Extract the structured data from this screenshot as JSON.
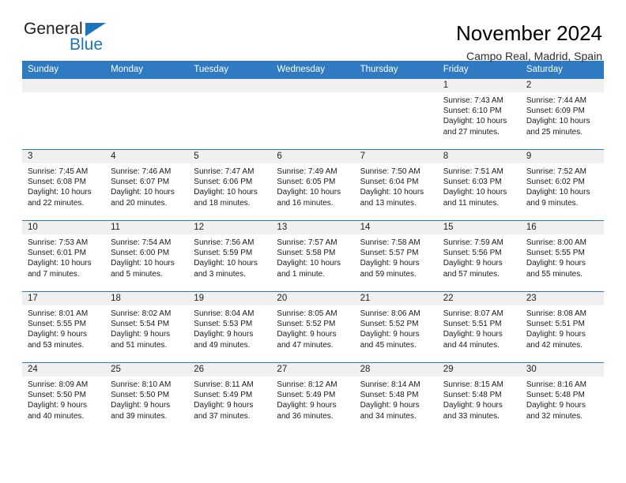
{
  "logo": {
    "word1": "General",
    "word2": "Blue",
    "triangle_color": "#1b75bb",
    "word1_color": "#231f20",
    "word2_color": "#1b75bb"
  },
  "header": {
    "title": "November 2024",
    "subtitle": "Campo Real, Madrid, Spain"
  },
  "theme": {
    "header_bg": "#2f7ac1",
    "header_text": "#ffffff",
    "daynum_bg": "#f0f0f0",
    "grid_line": "#2f7ac1"
  },
  "weekdays": [
    "Sunday",
    "Monday",
    "Tuesday",
    "Wednesday",
    "Thursday",
    "Friday",
    "Saturday"
  ],
  "weeks": [
    [
      {
        "day": "",
        "sunrise": "",
        "sunset": "",
        "daylight": "",
        "empty": true
      },
      {
        "day": "",
        "sunrise": "",
        "sunset": "",
        "daylight": "",
        "empty": true
      },
      {
        "day": "",
        "sunrise": "",
        "sunset": "",
        "daylight": "",
        "empty": true
      },
      {
        "day": "",
        "sunrise": "",
        "sunset": "",
        "daylight": "",
        "empty": true
      },
      {
        "day": "",
        "sunrise": "",
        "sunset": "",
        "daylight": "",
        "empty": true
      },
      {
        "day": "1",
        "sunrise": "Sunrise: 7:43 AM",
        "sunset": "Sunset: 6:10 PM",
        "daylight": "Daylight: 10 hours and 27 minutes.",
        "empty": false
      },
      {
        "day": "2",
        "sunrise": "Sunrise: 7:44 AM",
        "sunset": "Sunset: 6:09 PM",
        "daylight": "Daylight: 10 hours and 25 minutes.",
        "empty": false
      }
    ],
    [
      {
        "day": "3",
        "sunrise": "Sunrise: 7:45 AM",
        "sunset": "Sunset: 6:08 PM",
        "daylight": "Daylight: 10 hours and 22 minutes.",
        "empty": false
      },
      {
        "day": "4",
        "sunrise": "Sunrise: 7:46 AM",
        "sunset": "Sunset: 6:07 PM",
        "daylight": "Daylight: 10 hours and 20 minutes.",
        "empty": false
      },
      {
        "day": "5",
        "sunrise": "Sunrise: 7:47 AM",
        "sunset": "Sunset: 6:06 PM",
        "daylight": "Daylight: 10 hours and 18 minutes.",
        "empty": false
      },
      {
        "day": "6",
        "sunrise": "Sunrise: 7:49 AM",
        "sunset": "Sunset: 6:05 PM",
        "daylight": "Daylight: 10 hours and 16 minutes.",
        "empty": false
      },
      {
        "day": "7",
        "sunrise": "Sunrise: 7:50 AM",
        "sunset": "Sunset: 6:04 PM",
        "daylight": "Daylight: 10 hours and 13 minutes.",
        "empty": false
      },
      {
        "day": "8",
        "sunrise": "Sunrise: 7:51 AM",
        "sunset": "Sunset: 6:03 PM",
        "daylight": "Daylight: 10 hours and 11 minutes.",
        "empty": false
      },
      {
        "day": "9",
        "sunrise": "Sunrise: 7:52 AM",
        "sunset": "Sunset: 6:02 PM",
        "daylight": "Daylight: 10 hours and 9 minutes.",
        "empty": false
      }
    ],
    [
      {
        "day": "10",
        "sunrise": "Sunrise: 7:53 AM",
        "sunset": "Sunset: 6:01 PM",
        "daylight": "Daylight: 10 hours and 7 minutes.",
        "empty": false
      },
      {
        "day": "11",
        "sunrise": "Sunrise: 7:54 AM",
        "sunset": "Sunset: 6:00 PM",
        "daylight": "Daylight: 10 hours and 5 minutes.",
        "empty": false
      },
      {
        "day": "12",
        "sunrise": "Sunrise: 7:56 AM",
        "sunset": "Sunset: 5:59 PM",
        "daylight": "Daylight: 10 hours and 3 minutes.",
        "empty": false
      },
      {
        "day": "13",
        "sunrise": "Sunrise: 7:57 AM",
        "sunset": "Sunset: 5:58 PM",
        "daylight": "Daylight: 10 hours and 1 minute.",
        "empty": false
      },
      {
        "day": "14",
        "sunrise": "Sunrise: 7:58 AM",
        "sunset": "Sunset: 5:57 PM",
        "daylight": "Daylight: 9 hours and 59 minutes.",
        "empty": false
      },
      {
        "day": "15",
        "sunrise": "Sunrise: 7:59 AM",
        "sunset": "Sunset: 5:56 PM",
        "daylight": "Daylight: 9 hours and 57 minutes.",
        "empty": false
      },
      {
        "day": "16",
        "sunrise": "Sunrise: 8:00 AM",
        "sunset": "Sunset: 5:55 PM",
        "daylight": "Daylight: 9 hours and 55 minutes.",
        "empty": false
      }
    ],
    [
      {
        "day": "17",
        "sunrise": "Sunrise: 8:01 AM",
        "sunset": "Sunset: 5:55 PM",
        "daylight": "Daylight: 9 hours and 53 minutes.",
        "empty": false
      },
      {
        "day": "18",
        "sunrise": "Sunrise: 8:02 AM",
        "sunset": "Sunset: 5:54 PM",
        "daylight": "Daylight: 9 hours and 51 minutes.",
        "empty": false
      },
      {
        "day": "19",
        "sunrise": "Sunrise: 8:04 AM",
        "sunset": "Sunset: 5:53 PM",
        "daylight": "Daylight: 9 hours and 49 minutes.",
        "empty": false
      },
      {
        "day": "20",
        "sunrise": "Sunrise: 8:05 AM",
        "sunset": "Sunset: 5:52 PM",
        "daylight": "Daylight: 9 hours and 47 minutes.",
        "empty": false
      },
      {
        "day": "21",
        "sunrise": "Sunrise: 8:06 AM",
        "sunset": "Sunset: 5:52 PM",
        "daylight": "Daylight: 9 hours and 45 minutes.",
        "empty": false
      },
      {
        "day": "22",
        "sunrise": "Sunrise: 8:07 AM",
        "sunset": "Sunset: 5:51 PM",
        "daylight": "Daylight: 9 hours and 44 minutes.",
        "empty": false
      },
      {
        "day": "23",
        "sunrise": "Sunrise: 8:08 AM",
        "sunset": "Sunset: 5:51 PM",
        "daylight": "Daylight: 9 hours and 42 minutes.",
        "empty": false
      }
    ],
    [
      {
        "day": "24",
        "sunrise": "Sunrise: 8:09 AM",
        "sunset": "Sunset: 5:50 PM",
        "daylight": "Daylight: 9 hours and 40 minutes.",
        "empty": false
      },
      {
        "day": "25",
        "sunrise": "Sunrise: 8:10 AM",
        "sunset": "Sunset: 5:50 PM",
        "daylight": "Daylight: 9 hours and 39 minutes.",
        "empty": false
      },
      {
        "day": "26",
        "sunrise": "Sunrise: 8:11 AM",
        "sunset": "Sunset: 5:49 PM",
        "daylight": "Daylight: 9 hours and 37 minutes.",
        "empty": false
      },
      {
        "day": "27",
        "sunrise": "Sunrise: 8:12 AM",
        "sunset": "Sunset: 5:49 PM",
        "daylight": "Daylight: 9 hours and 36 minutes.",
        "empty": false
      },
      {
        "day": "28",
        "sunrise": "Sunrise: 8:14 AM",
        "sunset": "Sunset: 5:48 PM",
        "daylight": "Daylight: 9 hours and 34 minutes.",
        "empty": false
      },
      {
        "day": "29",
        "sunrise": "Sunrise: 8:15 AM",
        "sunset": "Sunset: 5:48 PM",
        "daylight": "Daylight: 9 hours and 33 minutes.",
        "empty": false
      },
      {
        "day": "30",
        "sunrise": "Sunrise: 8:16 AM",
        "sunset": "Sunset: 5:48 PM",
        "daylight": "Daylight: 9 hours and 32 minutes.",
        "empty": false
      }
    ]
  ]
}
